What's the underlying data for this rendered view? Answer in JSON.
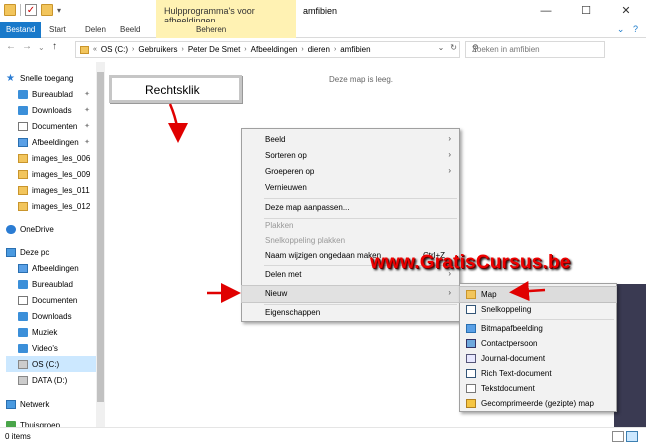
{
  "titlebar": {
    "context_tab_header": "Hulpprogramma's voor afbeeldingen",
    "window_title": "amfibien",
    "minimize": "—",
    "maximize": "☐",
    "close": "✕"
  },
  "ribbon": {
    "tabs": [
      "Bestand",
      "Start",
      "Delen",
      "Beeld",
      "Beheren"
    ],
    "help": "?",
    "expand": "⌄"
  },
  "address": {
    "back": "←",
    "forward": "→",
    "recent": "⌄",
    "up": "↑",
    "crumbs": [
      "OS (C:)",
      "Gebruikers",
      "Peter De Smet",
      "Afbeeldingen",
      "dieren",
      "amfibien"
    ],
    "search_placeholder": "Zoeken in amfibien"
  },
  "nav_pane": {
    "quick_access": "Snelle toegang",
    "quick_items": [
      "Bureaublad",
      "Downloads",
      "Documenten",
      "Afbeeldingen",
      "images_les_006",
      "images_les_009",
      "images_les_011",
      "images_les_012"
    ],
    "onedrive": "OneDrive",
    "this_pc": "Deze pc",
    "pc_items": [
      "Afbeeldingen",
      "Bureaublad",
      "Documenten",
      "Downloads",
      "Muziek",
      "Video's",
      "OS (C:)",
      "DATA (D:)"
    ],
    "network": "Netwerk",
    "homegroup": "Thuisgroep",
    "pin": "📌"
  },
  "content": {
    "empty_message": "Deze map is leeg."
  },
  "callout": {
    "text": "Rechtsklik"
  },
  "context_menu": {
    "items": [
      {
        "label": "Beeld",
        "submenu": "›"
      },
      {
        "label": "Sorteren op",
        "submenu": "›"
      },
      {
        "label": "Groeperen op",
        "submenu": "›"
      },
      {
        "label": "Vernieuwen"
      },
      {
        "label": "Deze map aanpassen..."
      },
      {
        "label": "Plakken"
      },
      {
        "label": "Snelkoppeling plakken"
      },
      {
        "label": "Naam wijzigen ongedaan maken",
        "shortcut": "Ctrl+Z"
      },
      {
        "label": "Delen met",
        "submenu": "›"
      },
      {
        "label": "Nieuw",
        "submenu": "›"
      },
      {
        "label": "Eigenschappen"
      }
    ]
  },
  "new_submenu": {
    "items": [
      "Map",
      "Snelkoppeling",
      "Bitmapafbeelding",
      "Contactpersoon",
      "Journal-document",
      "Rich Text-document",
      "Tekstdocument",
      "Gecomprimeerde (gezipte) map"
    ]
  },
  "watermark": "www.GratisCursus.be",
  "status": {
    "items_count": "0 items"
  },
  "colors": {
    "accent": "#1979ca",
    "context_tab": "#fff2b3",
    "arrow": "#e00000"
  }
}
